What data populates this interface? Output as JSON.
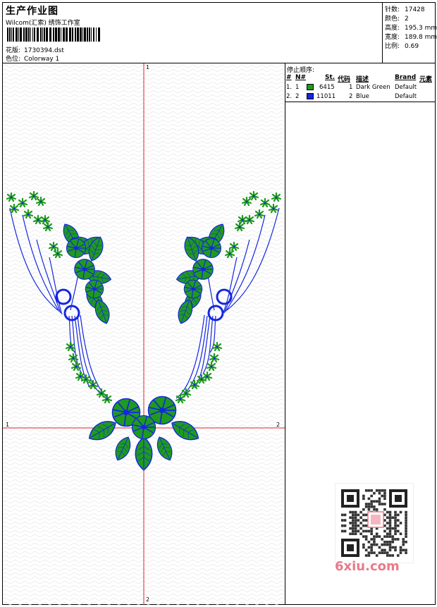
{
  "header": {
    "title": "生产作业图",
    "subtitle": "Wilcom(汇索) 绣饰工作室",
    "pattern_label": "花版:",
    "pattern_value": "1730394.dst",
    "colorway_label": "色位:",
    "colorway_value": "Colorway 1"
  },
  "stats": {
    "stitches_label": "针数:",
    "stitches_value": "17428",
    "colors_label": "颜色:",
    "colors_value": "2",
    "height_label": "高度:",
    "height_value": "195.3 mm",
    "width_label": "宽度:",
    "width_value": "189.8 mm",
    "ratio_label": "比例:",
    "ratio_value": "0.69"
  },
  "canvas": {
    "axis_top": "1",
    "axis_bottom": "2",
    "axis_left": "1",
    "axis_right": "2"
  },
  "stop_sequence": {
    "title": "停止顺序:",
    "headers": {
      "num": "#",
      "n": "N#",
      "st": "St.",
      "code": "代码",
      "desc": "描述",
      "brand": "Brand",
      "elem": "元素"
    },
    "rows": [
      {
        "num": "1.",
        "n": "1",
        "color": "#1f9a1f",
        "st": "6415",
        "code": "1",
        "desc": "Dark Green",
        "brand": "Default"
      },
      {
        "num": "2.",
        "n": "2",
        "color": "#1426e0",
        "st": "11011",
        "code": "2",
        "desc": "Blue",
        "brand": "Default"
      }
    ]
  },
  "watermark": {
    "text": "6xiu.com"
  },
  "colors": {
    "green": "#1f9a1f",
    "blue": "#1426e0",
    "axis": "#e0202a"
  }
}
